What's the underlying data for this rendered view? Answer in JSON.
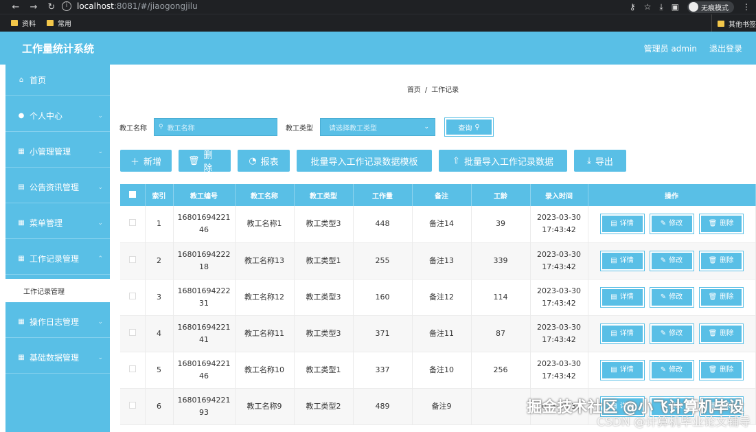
{
  "browser": {
    "url_host": "localhost",
    "url_path": ":8081/#/jiaogongjilu",
    "incognito_label": "无痕模式",
    "bookmarks": [
      "资料",
      "常用"
    ],
    "bookmarks_right": "其他书签"
  },
  "app": {
    "title": "工作量统计系统",
    "user": "管理员 admin",
    "logout": "退出登录",
    "accent_color": "#59bfe6"
  },
  "sidebar": {
    "items": [
      {
        "label": "首页",
        "icon": "home-icon"
      },
      {
        "label": "个人中心",
        "icon": "user-icon"
      },
      {
        "label": "小管理管理",
        "icon": "grid-icon"
      },
      {
        "label": "公告资讯管理",
        "icon": "notice-icon"
      },
      {
        "label": "菜单管理",
        "icon": "grid-icon"
      },
      {
        "label": "工作记录管理",
        "icon": "grid-icon"
      },
      {
        "label": "操作日志管理",
        "icon": "grid-icon"
      },
      {
        "label": "基础数据管理",
        "icon": "grid-icon"
      }
    ],
    "submenu_label": "工作记录管理"
  },
  "breadcrumb": {
    "home": "首页",
    "sep": "/",
    "current": "工作记录"
  },
  "search": {
    "name_label": "教工名称",
    "name_placeholder": "教工名称",
    "type_label": "教工类型",
    "type_placeholder": "请选择教工类型",
    "query_label": "查询"
  },
  "actions": {
    "add": "新增",
    "delete": "删除",
    "report": "报表",
    "import_template": "批量导入工作记录数据模板",
    "import_data": "批量导入工作记录数据",
    "export": "导出"
  },
  "table": {
    "headers": [
      "索引",
      "教工编号",
      "教工名称",
      "教工类型",
      "工作量",
      "备注",
      "工龄",
      "录入时间",
      "操作"
    ],
    "rows": [
      {
        "idx": "1",
        "no1": "16801694221",
        "no2": "46",
        "name": "教工名称1",
        "type": "教工类型3",
        "work": "448",
        "note": "备注14",
        "age": "39",
        "date": "2023-03-30",
        "time": "17:43:42"
      },
      {
        "idx": "2",
        "no1": "16801694222",
        "no2": "18",
        "name": "教工名称13",
        "type": "教工类型1",
        "work": "255",
        "note": "备注13",
        "age": "339",
        "date": "2023-03-30",
        "time": "17:43:42"
      },
      {
        "idx": "3",
        "no1": "16801694222",
        "no2": "31",
        "name": "教工名称12",
        "type": "教工类型3",
        "work": "160",
        "note": "备注12",
        "age": "114",
        "date": "2023-03-30",
        "time": "17:43:42"
      },
      {
        "idx": "4",
        "no1": "16801694221",
        "no2": "41",
        "name": "教工名称11",
        "type": "教工类型3",
        "work": "371",
        "note": "备注11",
        "age": "87",
        "date": "2023-03-30",
        "time": "17:43:42"
      },
      {
        "idx": "5",
        "no1": "16801694221",
        "no2": "46",
        "name": "教工名称10",
        "type": "教工类型1",
        "work": "337",
        "note": "备注10",
        "age": "256",
        "date": "2023-03-30",
        "time": "17:43:42"
      },
      {
        "idx": "6",
        "no1": "16801694221",
        "no2": "93",
        "name": "教工名称9",
        "type": "教工类型2",
        "work": "489",
        "note": "备注9",
        "age": "",
        "date": "2023-03-30",
        "time": ""
      }
    ],
    "op_detail": "详情",
    "op_edit": "修改",
    "op_delete": "删除"
  },
  "watermark": {
    "line1": "掘金技术社区 @小飞计算机毕设",
    "line2": "CSDN @计算机毕业论文辅导"
  }
}
